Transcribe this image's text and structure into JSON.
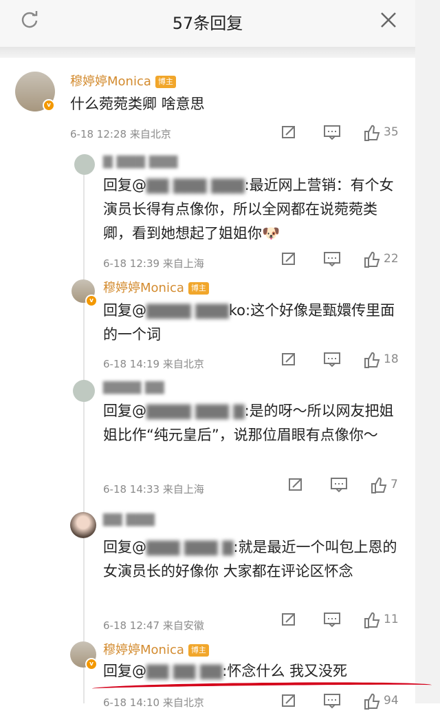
{
  "header": {
    "title": "57条回复"
  },
  "comments": [
    {
      "name": "穆婷婷Monica",
      "badge": "博主",
      "text": "什么菀菀类卿 啥意思",
      "time": "6-18 12:28",
      "location": "来自北京",
      "likes": "35"
    },
    {
      "name": "▇ ▇▇▇ ▇▇▇",
      "text_prefix": "回复@",
      "mention": "▇▇ ▇▇▇ ▇▇▇",
      "text": ":最近网上营销：有个女演员长得有点像你，所以全网都在说菀菀类卿，看到她想起了姐姐你",
      "emoji": "🐶",
      "time": "6-18 12:39",
      "location": "来自上海",
      "likes": "22"
    },
    {
      "name": "穆婷婷Monica",
      "badge": "博主",
      "text_prefix": "回复@",
      "mention": "▇▇▇▇ ▇▇▇",
      "text": "ko:这个好像是甄嬛传里面的一个词",
      "time": "6-18 14:19",
      "location": "来自北京",
      "likes": "18"
    },
    {
      "name": "▇▇▇▇ ▇▇",
      "text_prefix": "回复@",
      "mention": "▇▇▇▇ ▇▇▇ ▇",
      "text": ":是的呀～所以网友把姐姐比作“纯元皇后”，说那位眉眼有点像你～",
      "time": "6-18 14:33",
      "location": "来自上海",
      "likes": "7"
    },
    {
      "name": "▇▇ ▇▇▇",
      "text_prefix": "回复@",
      "mention": "▇▇▇ ▇▇▇ ▇",
      "text": ":就是最近一个叫包上恩的女演员长的好像你  大家都在评论区怀念",
      "time": "6-18 12:47",
      "location": "来自安徽",
      "likes": "11"
    },
    {
      "name": "穆婷婷Monica",
      "badge": "博主",
      "text_prefix": "回复@",
      "mention": "▇▇ ▇▇ ▇▇",
      "text": ":怀念什么 我又没死",
      "time": "6-18 14:10",
      "location": "来自北京",
      "likes": "94"
    }
  ],
  "colors": {
    "name": "#d38b2f",
    "badge": "#f1a62b",
    "highlight": "#d4001a"
  },
  "icons": [
    "refresh-icon",
    "close-icon",
    "repost-icon",
    "comment-icon",
    "like-icon"
  ]
}
